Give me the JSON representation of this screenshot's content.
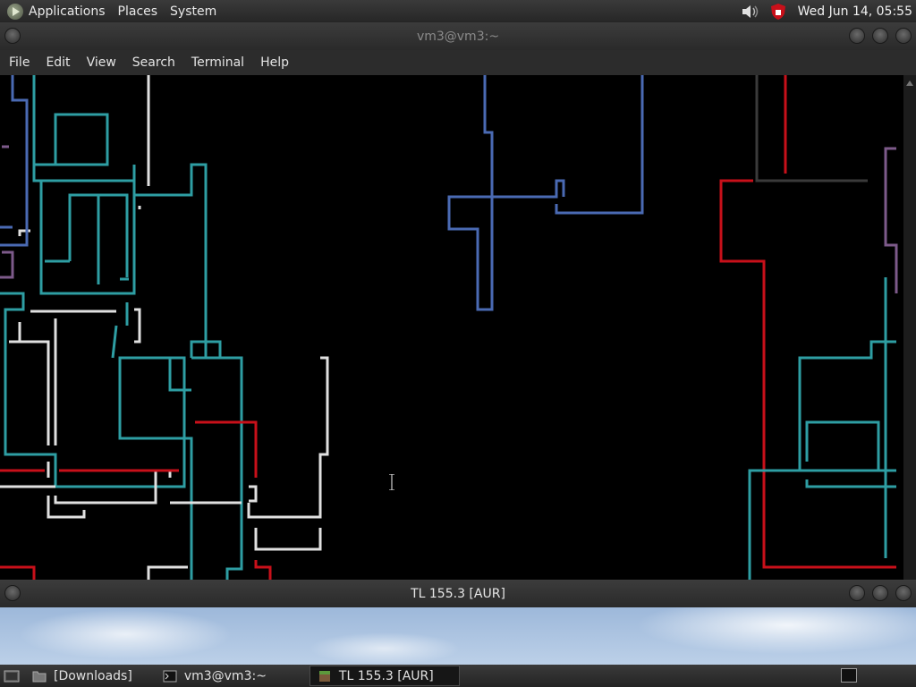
{
  "top_panel": {
    "menus": [
      "Applications",
      "Places",
      "System"
    ],
    "clock": "Wed Jun 14, 05:55"
  },
  "terminal": {
    "title": "vm3@vm3:~",
    "menu": [
      "File",
      "Edit",
      "View",
      "Search",
      "Terminal",
      "Help"
    ]
  },
  "tl_window": {
    "title": "TL 155.3 [AUR]"
  },
  "taskbar": {
    "items": [
      {
        "label": "[Downloads]",
        "icon": "folder-icon"
      },
      {
        "label": "vm3@vm3:~",
        "icon": "terminal-icon"
      },
      {
        "label": "TL 155.3 [AUR]",
        "icon": "minecraft-block-icon"
      }
    ]
  },
  "colors": {
    "teal": "#2e9ea3",
    "blue": "#4a6ab3",
    "red": "#c8101a",
    "white": "#e0e0e0",
    "purple": "#7d5a8a",
    "gray": "#3a3a3a"
  }
}
